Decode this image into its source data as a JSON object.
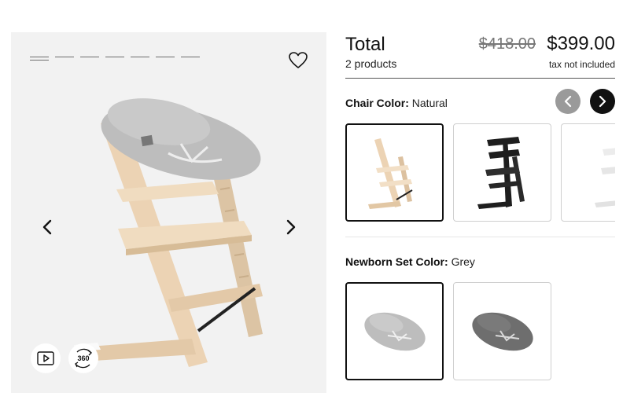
{
  "gallery": {
    "slide_count": 7,
    "active_index": 0,
    "spin_label": "360"
  },
  "summary": {
    "title": "Total",
    "count": "2 products",
    "old_price": "$418.00",
    "price": "$399.00",
    "tax_note": "tax not included"
  },
  "chair_color": {
    "label": "Chair Color:",
    "value": "Natural",
    "options": [
      "Natural",
      "Black",
      "White"
    ],
    "selected": 0
  },
  "newborn_color": {
    "label": "Newborn Set Color:",
    "value": "Grey",
    "options": [
      "Grey",
      "Dark Grey"
    ],
    "selected": 0
  },
  "colors": {
    "natural_wood": "#ecd3b4",
    "black": "#1e1e1e",
    "white": "#f4f4f4",
    "grey_cushion": "#b7b7b7",
    "dark_grey_cushion": "#686868",
    "nav_disabled": "#9a9a9a",
    "nav_active": "#111111"
  },
  "icons": {
    "favorite": "heart-icon",
    "prev": "chevron-left-icon",
    "next": "chevron-right-icon",
    "video": "play-video-icon",
    "spin": "rotate-360-icon"
  }
}
